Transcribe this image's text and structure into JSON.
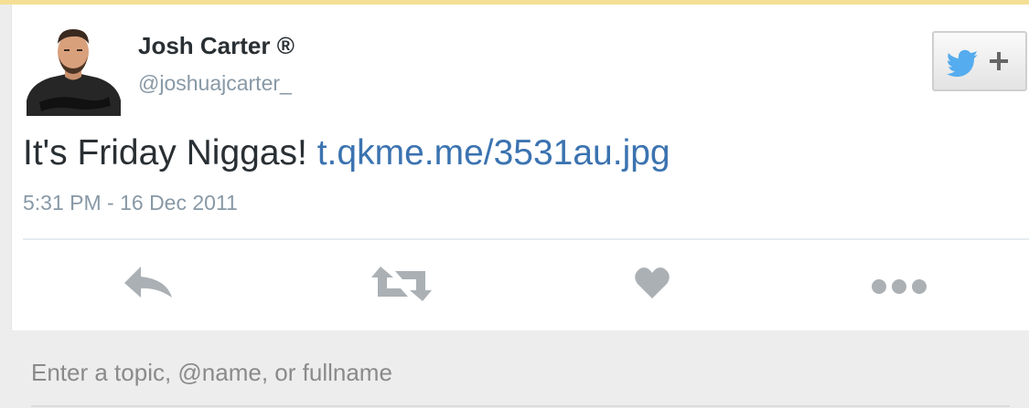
{
  "tweet": {
    "user": {
      "display_name": "Josh Carter ®",
      "handle": "@joshuajcarter_",
      "avatar_icon": "user-avatar"
    },
    "text": "It's Friday Niggas! ",
    "link": "t.qkme.me/3531au.jpg",
    "timestamp": "5:31 PM - 16 Dec 2011",
    "follow_button": {
      "icon": "twitter-bird-plus-icon",
      "color": "#55acee"
    },
    "actions": [
      {
        "name": "reply",
        "icon": "reply-icon"
      },
      {
        "name": "retweet",
        "icon": "retweet-icon"
      },
      {
        "name": "favorite",
        "icon": "heart-icon"
      },
      {
        "name": "more",
        "icon": "ellipsis-icon"
      }
    ]
  },
  "search": {
    "placeholder": "Enter a topic, @name, or fullname"
  },
  "colors": {
    "link": "#3b73b0",
    "muted_text": "#8899a6",
    "action_icon": "#aab0b4",
    "top_strip": "#f5df95"
  }
}
